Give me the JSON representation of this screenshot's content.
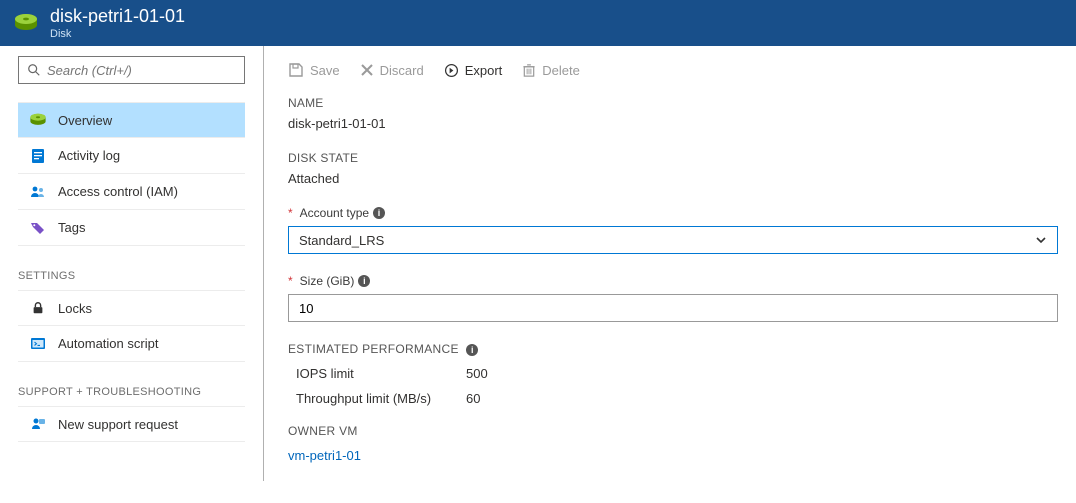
{
  "header": {
    "title": "disk-petri1-01-01",
    "subtitle": "Disk"
  },
  "search": {
    "placeholder": "Search (Ctrl+/)"
  },
  "nav": {
    "main": [
      {
        "label": "Overview",
        "icon": "disk"
      },
      {
        "label": "Activity log",
        "icon": "log"
      },
      {
        "label": "Access control (IAM)",
        "icon": "iam"
      },
      {
        "label": "Tags",
        "icon": "tag"
      }
    ],
    "settings_label": "SETTINGS",
    "settings": [
      {
        "label": "Locks",
        "icon": "lock"
      },
      {
        "label": "Automation script",
        "icon": "script"
      }
    ],
    "support_label": "SUPPORT + TROUBLESHOOTING",
    "support": [
      {
        "label": "New support request",
        "icon": "support"
      }
    ]
  },
  "toolbar": {
    "save": "Save",
    "discard": "Discard",
    "export": "Export",
    "delete": "Delete"
  },
  "fields": {
    "name_label": "NAME",
    "name_value": "disk-petri1-01-01",
    "state_label": "DISK STATE",
    "state_value": "Attached",
    "account_type_label": "Account type",
    "account_type_value": "Standard_LRS",
    "size_label": "Size (GiB)",
    "size_value": "10",
    "perf_label": "ESTIMATED PERFORMANCE",
    "iops_label": "IOPS limit",
    "iops_value": "500",
    "throughput_label": "Throughput limit (MB/s)",
    "throughput_value": "60",
    "owner_label": "OWNER VM",
    "owner_value": "vm-petri1-01"
  }
}
